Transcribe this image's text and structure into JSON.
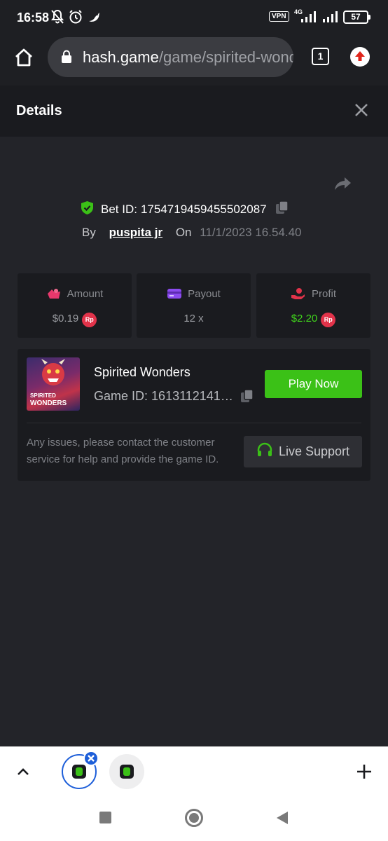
{
  "status_bar": {
    "time": "16:58",
    "vpn": "VPN",
    "network": "4G",
    "battery": "57"
  },
  "browser": {
    "domain": "hash.game",
    "path": "/game/spirited-wonders",
    "tab_count": "1"
  },
  "details": {
    "title": "Details",
    "bet_id_label": "Bet ID:",
    "bet_id": "1754719459455502087",
    "by_label": "By",
    "user": "puspita jr",
    "on_label": "On",
    "date": "11/1/2023 16.54.40"
  },
  "stats": {
    "amount_label": "Amount",
    "amount_value": "$0.19",
    "payout_label": "Payout",
    "payout_value": "12 x",
    "profit_label": "Profit",
    "profit_value": "$2.20",
    "currency_badge": "Rp"
  },
  "game": {
    "name": "Spirited Wonders",
    "id_label": "Game ID:",
    "id": "16131121416...",
    "thumb_line1": "SPIRITED",
    "thumb_line2": "WONDERS",
    "play_label": "Play Now",
    "support_text": "Any issues, please contact the customer service for help and provide the game ID.",
    "support_label": "Live Support"
  },
  "colors": {
    "accent_green": "#3bc117",
    "profit_green": "#40d51c",
    "rp_red": "#e2334a"
  }
}
